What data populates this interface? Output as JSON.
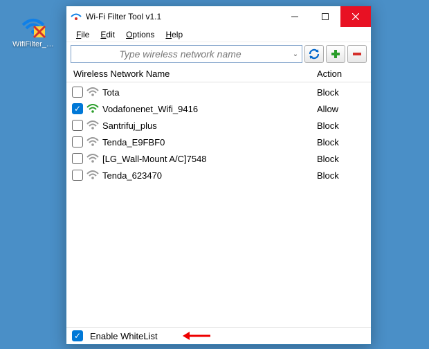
{
  "desktop": {
    "icon_label": "WifiFilter_x..."
  },
  "window": {
    "title": "Wi-Fi Filter Tool v1.1",
    "menu": {
      "file": "File",
      "edit": "Edit",
      "options": "Options",
      "help": "Help"
    },
    "search": {
      "placeholder": "Type wireless network name"
    },
    "columns": {
      "name": "Wireless Network Name",
      "action": "Action"
    },
    "footer": {
      "enable_whitelist": "Enable WhiteList"
    }
  },
  "networks": [
    {
      "name": "Tota",
      "action": "Block",
      "checked": false,
      "strong": false
    },
    {
      "name": "Vodafonenet_Wifi_9416",
      "action": "Allow",
      "checked": true,
      "strong": true
    },
    {
      "name": "Santrifuj_plus",
      "action": "Block",
      "checked": false,
      "strong": false
    },
    {
      "name": "Tenda_E9FBF0",
      "action": "Block",
      "checked": false,
      "strong": false
    },
    {
      "name": "[LG_Wall-Mount A/C]7548",
      "action": "Block",
      "checked": false,
      "strong": false
    },
    {
      "name": "Tenda_623470",
      "action": "Block",
      "checked": false,
      "strong": false
    }
  ]
}
